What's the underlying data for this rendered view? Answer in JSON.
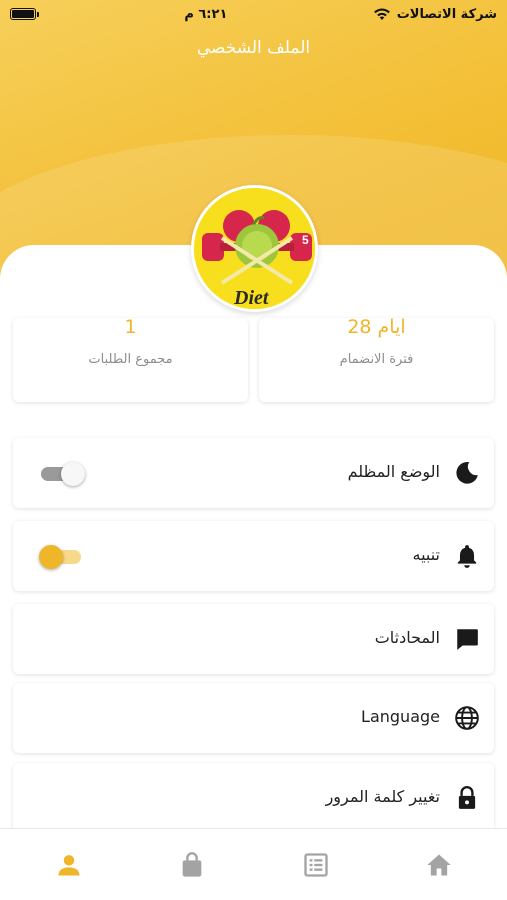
{
  "status_bar": {
    "carrier": "شركة الاتصالات",
    "time": "٦:٢١ م"
  },
  "header": {
    "title": "الملف الشخصي"
  },
  "profile": {
    "avatar_text": "Diet",
    "avatar_number": "5"
  },
  "stats": [
    {
      "value": "28 ايام",
      "label": "فترة الانضمام"
    },
    {
      "value": "1",
      "label": "مجموع الطلبات"
    }
  ],
  "menu": [
    {
      "label": "الوضع المظلم",
      "icon": "moon-icon",
      "toggle": "off"
    },
    {
      "label": "تنبيه",
      "icon": "bell-icon",
      "toggle": "on"
    },
    {
      "label": "المحادثات",
      "icon": "chat-icon"
    },
    {
      "label": "Language",
      "icon": "globe-icon"
    },
    {
      "label": "تغيير كلمة المرور",
      "icon": "lock-icon"
    }
  ],
  "bottom_nav": {
    "items": [
      "person-icon",
      "shopping-bag-icon",
      "list-icon",
      "home-icon"
    ],
    "active": "person-icon"
  },
  "colors": {
    "accent": "#f0b62a",
    "inactive_icon": "#a3a3a3"
  }
}
